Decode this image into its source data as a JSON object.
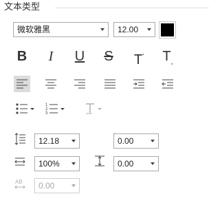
{
  "section": {
    "title": "文本类型"
  },
  "font": {
    "family": "微软雅黑",
    "size": "12.00",
    "color": "#000000"
  },
  "style_buttons": [
    {
      "name": "bold",
      "glyph": "B"
    },
    {
      "name": "italic",
      "glyph": "I"
    },
    {
      "name": "underline",
      "glyph": "U"
    },
    {
      "name": "strikethrough",
      "glyph": "S"
    },
    {
      "name": "superscript",
      "glyph": "T",
      "mark": "'"
    },
    {
      "name": "subscript",
      "glyph": "T",
      "mark": ","
    }
  ],
  "align_buttons": [
    "align-left",
    "align-center",
    "align-right",
    "justify",
    "indent",
    "outdent"
  ],
  "list_buttons": [
    "bullet-list",
    "numbered-list",
    "text-style"
  ],
  "spacing": {
    "line_spacing": "12.18",
    "paragraph_spacing": "0.00",
    "char_scale": "100%",
    "baseline_offset": "0.00",
    "char_spacing": "0.00"
  },
  "colors": {
    "accent_active": "#dcdcdc",
    "border": "#a9a9a9"
  }
}
